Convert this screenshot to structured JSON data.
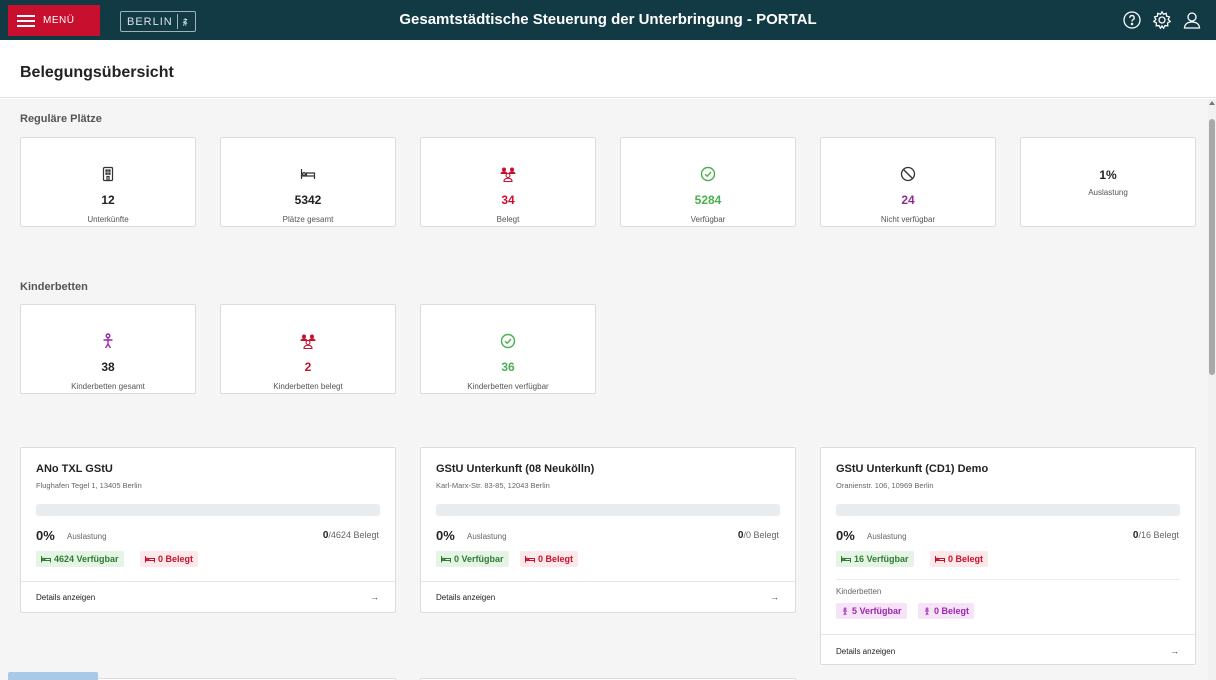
{
  "header": {
    "menu_label": "MENÜ",
    "logo_text": "BERLIN",
    "title": "Gesamtstädtische Steuerung der Unterbringung - PORTAL",
    "icons": [
      "help-icon",
      "settings-icon",
      "user-icon"
    ]
  },
  "page": {
    "title": "Belegungsübersicht"
  },
  "regular": {
    "label": "Reguläre Plätze",
    "cards": [
      {
        "icon": "building-icon",
        "value": "12",
        "label": "Unterkünfte",
        "color": "#222222"
      },
      {
        "icon": "bed-icon",
        "value": "5342",
        "label": "Plätze gesamt",
        "color": "#222222"
      },
      {
        "icon": "people-icon",
        "value": "34",
        "label": "Belegt",
        "color": "#c8102e"
      },
      {
        "icon": "check-circle-icon",
        "value": "5284",
        "label": "Verfügbar",
        "color": "#4caf50"
      },
      {
        "icon": "block-icon",
        "value": "24",
        "label": "Nicht verfügbar",
        "color": "#8e2f8e"
      },
      {
        "icon": "",
        "value": "1%",
        "label": "Auslastung",
        "color": "#222222"
      }
    ]
  },
  "children": {
    "label": "Kinderbetten",
    "cards": [
      {
        "icon": "child-icon",
        "value": "38",
        "label": "Kinderbetten gesamt",
        "color": "#222222"
      },
      {
        "icon": "people-icon",
        "value": "2",
        "label": "Kinderbetten belegt",
        "color": "#c8102e"
      },
      {
        "icon": "check-circle-icon",
        "value": "36",
        "label": "Kinderbetten verfügbar",
        "color": "#4caf50"
      }
    ]
  },
  "facilities": [
    {
      "name": "ANo TXL GStU",
      "address": "Flughafen Tegel 1, 13405 Berlin",
      "utilization_pct": 0,
      "pct_text": "0%",
      "pct_label": "Auslastung",
      "occupied": "0",
      "capacity": "/4624",
      "occupied_label": "Belegt",
      "available_badge": "4624 Verfügbar",
      "occupied_badge": "0 Belegt",
      "details": "Details anzeigen",
      "arrow": "→"
    },
    {
      "name": "GStU Unterkunft (08 Neukölln)",
      "address": "Karl-Marx-Str. 83-85, 12043 Berlin",
      "utilization_pct": 0,
      "pct_text": "0%",
      "pct_label": "Auslastung",
      "occupied": "0",
      "capacity": "/0",
      "occupied_label": "Belegt",
      "available_badge": "0 Verfügbar",
      "occupied_badge": "0 Belegt",
      "details": "Details anzeigen",
      "arrow": "→"
    },
    {
      "name": "GStU Unterkunft (CD1) Demo",
      "address": "Oranienstr. 106, 10969 Berlin",
      "utilization_pct": 0,
      "pct_text": "0%",
      "pct_label": "Auslastung",
      "occupied": "0",
      "capacity": "/16",
      "occupied_label": "Belegt",
      "available_badge": "16 Verfügbar",
      "occupied_badge": "0 Belegt",
      "kinderbetten_label": "Kinderbetten",
      "kb_available_badge": "5 Verfügbar",
      "kb_occupied_badge": "0 Belegt",
      "details": "Details anzeigen",
      "arrow": "→"
    }
  ],
  "colors": {
    "topbar": "#123a45",
    "accent_red": "#c8102e",
    "green": "#4caf50",
    "purple": "#8e2f8e"
  }
}
